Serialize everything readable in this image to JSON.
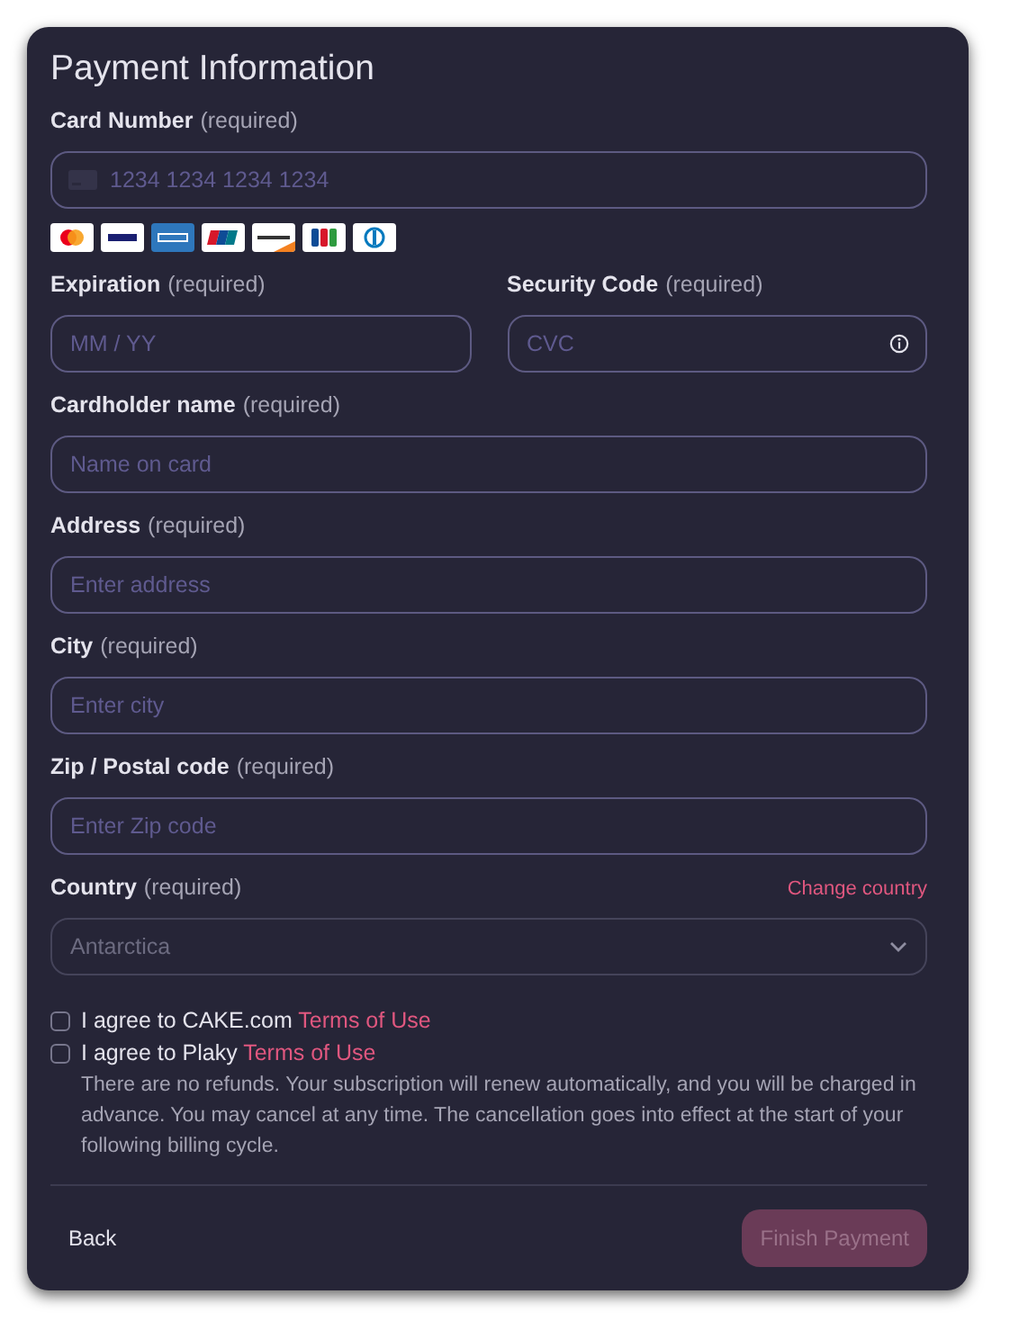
{
  "title": "Payment Information",
  "rows": [
    [
      {
        "kind": "card",
        "label": "Card Number",
        "note": "(required)",
        "placeholder": "1234 1234 1234 1234"
      }
    ],
    [
      {
        "kind": "text",
        "label": "Expiration",
        "note": "(required)",
        "placeholder": "MM / YY"
      },
      {
        "kind": "info",
        "label": "Security Code",
        "note": "(required)",
        "placeholder": "CVC"
      }
    ],
    [
      {
        "kind": "text",
        "label": "Cardholder name",
        "note": "(required)",
        "placeholder": "Name on card"
      }
    ],
    [
      {
        "kind": "text",
        "label": "Address",
        "note": "(required)",
        "placeholder": "Enter address"
      }
    ],
    [
      {
        "kind": "text",
        "label": "City",
        "note": "(required)",
        "placeholder": "Enter city"
      }
    ],
    [
      {
        "kind": "text",
        "label": "Zip / Postal code",
        "note": "(required)",
        "placeholder": "Enter Zip code"
      }
    ],
    [
      {
        "kind": "select",
        "label": "Country",
        "note": "(required)",
        "link": "Change country",
        "value": "Antarctica",
        "disabled": true
      }
    ]
  ],
  "agreements": [
    {
      "text": "I agree to CAKE.com",
      "link": "Terms of Use",
      "checked": false
    },
    {
      "text": "I agree to Plaky",
      "link": "Terms of Use",
      "checked": false
    }
  ],
  "disclaimer": "There are no refunds. Your subscription will renew automatically, and you will be charged in advance. You may cancel at any time. The cancellation goes into effect at the start of your following billing cycle.",
  "back": {
    "label": "Back"
  },
  "finish": {
    "label": "Finish Payment",
    "disabled": true
  }
}
